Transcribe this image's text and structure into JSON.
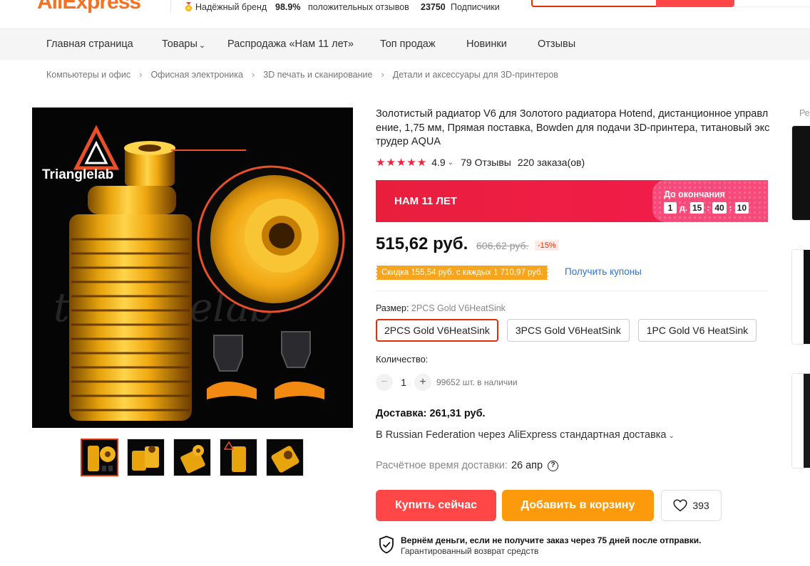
{
  "store_header": {
    "logo": "AliExpress",
    "brand_badge": "Надёжный бренд",
    "positive_pct": "98.9%",
    "positive_label": "положительных отзывов",
    "subscribers_count": "23750",
    "subscribers_label": "Подписчики"
  },
  "nav": {
    "items": [
      "Главная страница",
      "Товары",
      "Распродажа «Нам 11 лет»",
      "Топ продаж",
      "Новинки",
      "Отзывы"
    ]
  },
  "breadcrumb": [
    "Компьютеры и офис",
    "Офисная электроника",
    "3D печать и сканирование",
    "Детали и аксессуары для 3D-принтеров"
  ],
  "product": {
    "title": "Золотистый радиатор V6 для Золотого радиатора Hotend, дистанционное управление, 1,75 мм, Прямая поставка, Bowden для подачи 3D-принтера, титановый экструдер AQUA",
    "image_logo": "Trianglelab",
    "image_watermark": "trianglelab",
    "rating": "4.9",
    "rating_stars": 5,
    "reviews": "79 Отзывы",
    "orders": "220 заказа(ов)"
  },
  "promo": {
    "title": "НАМ 11 ЛЕТ",
    "until_label": "До окончания",
    "days": "1",
    "days_unit": "д.",
    "hours": "15",
    "minutes": "40",
    "seconds": "10"
  },
  "price": {
    "current": "515,62 руб.",
    "old": "606,62 руб.",
    "discount": "-15%"
  },
  "coupon": {
    "tag": "Скидка 155,54 руб. с каждых 1 710,97 руб.",
    "link": "Получить купоны"
  },
  "size": {
    "label": "Размер:",
    "selected": "2PCS Gold V6HeatSink",
    "options": [
      "2PCS Gold V6HeatSink",
      "3PCS Gold V6HeatSink",
      "1PC Gold V6 HeatSink"
    ]
  },
  "quantity": {
    "label": "Количество:",
    "minus": "−",
    "value": "1",
    "plus": "+",
    "stock": "99652 шт. в наличии"
  },
  "shipping": {
    "title": "Доставка: 261,31 руб.",
    "method": "В Russian Federation через AliExpress стандартная доставка",
    "eta_label": "Расчётное время доставки:",
    "eta_value": "26 апр",
    "help_icon": "?"
  },
  "actions": {
    "buy_now": "Купить сейчас",
    "add_to_cart": "Добавить в корзину",
    "wishlist_count": "393"
  },
  "guarantee": {
    "main": "Вернём деньги, если не получите заказ через 75 дней после отправки.",
    "sub": "Гарантированный возврат средств"
  },
  "recommendations": {
    "label_partial": "Ре"
  },
  "colors": {
    "accent_red": "#ff4747",
    "accent_orange": "#fd9a0c",
    "link_blue": "#2874d8",
    "promo_red": "#e91e3c"
  }
}
